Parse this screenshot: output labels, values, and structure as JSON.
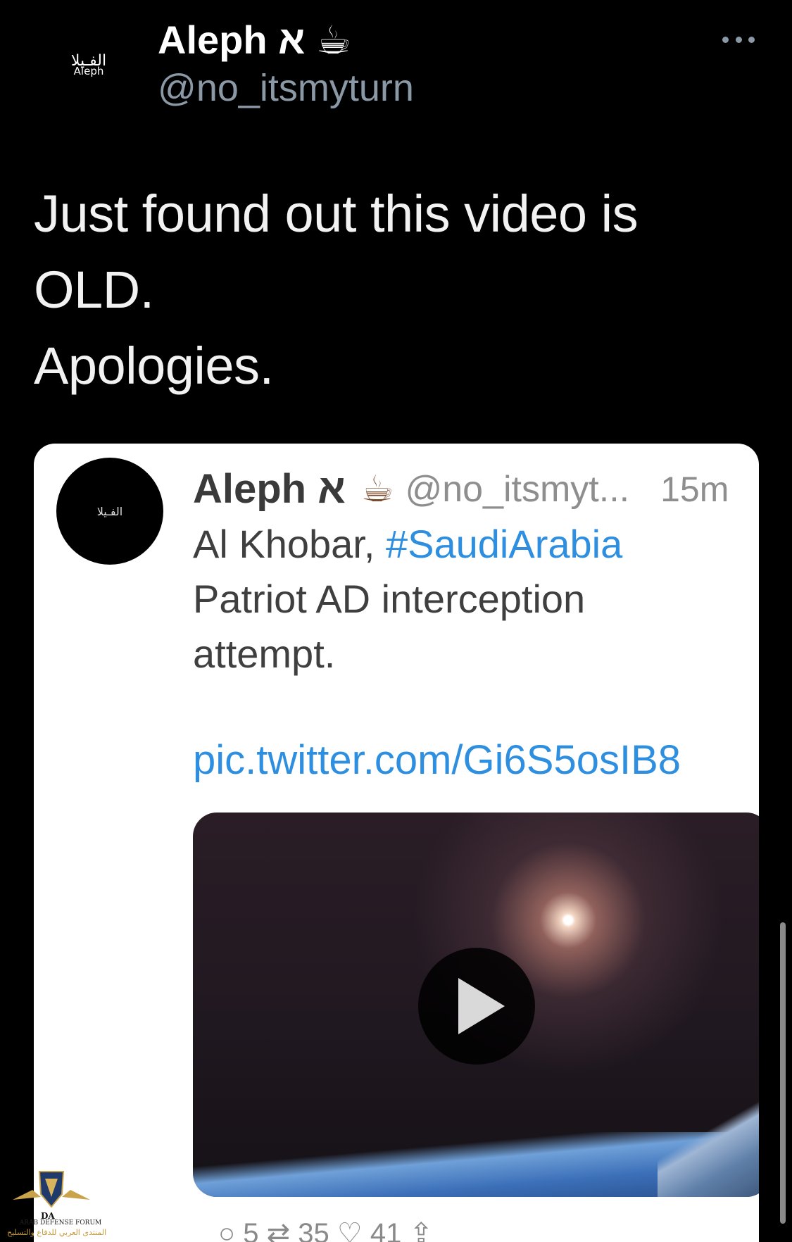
{
  "tweet": {
    "avatar_text_ar": "الفـيلا",
    "avatar_text_en": "Aleph",
    "display_name": "Aleph א ☕",
    "handle": "@no_itsmyturn",
    "more_icon": "more-horizontal-icon",
    "text_lines": [
      "Just found out this video is",
      "OLD.",
      "Apologies."
    ]
  },
  "quoted": {
    "avatar_text": "الفـيلا",
    "name": "Aleph א",
    "cup_icon": "☕",
    "handle": "@no_itsmyt...",
    "time": "15m",
    "body_line1_prefix": "Al Khobar, ",
    "body_line1_hashtag": "#SaudiArabia",
    "body_line2": "Patriot AD interception",
    "body_line3": "attempt.",
    "url": "pic.twitter.com/Gi6S5osIB8",
    "video_play_icon": "play-icon",
    "actions_partial": "○ 5   ⇄ 35   ♡ 41   ⇪"
  },
  "watermark": {
    "abbr": "DA",
    "en": "ARAB DEFENSE FORUM",
    "ar": "المنتدى العربي للدفاع والتسليح"
  },
  "colors": {
    "background": "#000000",
    "handle_gray": "#8b98a5",
    "link_blue": "#2e8fe0"
  }
}
